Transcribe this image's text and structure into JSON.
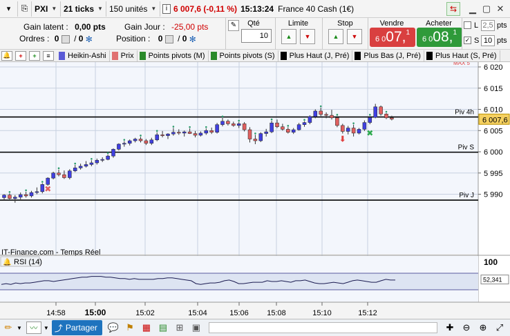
{
  "titlebar": {
    "symbol": "PXI",
    "interval": "21 ticks",
    "units": "150 unités",
    "price_change": "6 007,6 (-0,11 %)",
    "time": "15:13:24",
    "instrument": "France 40 Cash (1€)"
  },
  "infobar": {
    "gain_latent_label": "Gain latent :",
    "gain_latent_value": "0,00 pts",
    "gain_jour_label": "Gain Jour :",
    "gain_jour_value": "-25,00 pts",
    "ordres_label": "Ordres :",
    "ordres_a": "0",
    "ordres_b": "0",
    "position_label": "Position :",
    "position_a": "0",
    "position_b": "0",
    "qty_label": "Qté",
    "qty_value": "10",
    "limit_label": "Limite",
    "stop_label": "Stop",
    "sell_label": "Vendre",
    "sell_prefix": "6 0",
    "sell_big": "07,",
    "sell_sup": "1",
    "buy_label": "Acheter",
    "buy_prefix": "6 0",
    "buy_big": "08,",
    "buy_sup": "1",
    "l_label": "L",
    "l_value": "2,5",
    "l_unit": "pts",
    "s_label": "S",
    "s_value": "10",
    "s_unit": "pts"
  },
  "indicators": [
    {
      "label": "Heikin-Ashi",
      "color": "#5b5bd6"
    },
    {
      "label": "Prix",
      "color": "#e07070"
    },
    {
      "label": "Points pivots (M)",
      "color": "#2a8a2a"
    },
    {
      "label": "Points pivots (S)",
      "color": "#2a8a2a"
    },
    {
      "label": "Plus Haut (J, Pré)",
      "color": "#000000"
    },
    {
      "label": "Plus Bas (J, Pré)",
      "color": "#000000"
    },
    {
      "label": "Plus Haut (S, Pré)",
      "color": "#000000"
    }
  ],
  "chart": {
    "y_ticks": [
      "6 020",
      "6 015",
      "6 010",
      "6 005",
      "6 000",
      "5 995",
      "5 990"
    ],
    "pivot_lines": [
      {
        "label": "Piv 4h",
        "value": 6008.2
      },
      {
        "label": "Piv S",
        "value": 5999.9
      },
      {
        "label": "Piv J",
        "value": 5988.6
      }
    ],
    "top_line_label": "MAX 5",
    "current_price": "6 007,6",
    "watermark": "IT-Finance.com - Temps Réel",
    "rsi_label": "RSI (14)",
    "rsi_value": "52,341",
    "rsi_top_label": "100",
    "x_ticks": [
      "14:58",
      "15:00",
      "15:02",
      "15:04",
      "15:06",
      "15:08",
      "15:10",
      "15:12"
    ],
    "x_bold_tick": "15:00",
    "colors": {
      "up": "#4040e0",
      "down": "#e06060",
      "grid": "#c7d0e0",
      "bg": "#f3f6fc",
      "rsi_band": "#dde4f2"
    }
  },
  "candles": [
    [
      5989.2,
      5990.0,
      5988.6,
      5989.8
    ],
    [
      5989.8,
      5990.2,
      5988.8,
      5989.0
    ],
    [
      5989.0,
      5989.8,
      5988.0,
      5989.3
    ],
    [
      5989.3,
      5990.4,
      5988.8,
      5989.9
    ],
    [
      5989.9,
      5990.6,
      5989.2,
      5989.6
    ],
    [
      5989.6,
      5990.8,
      5989.2,
      5990.4
    ],
    [
      5990.4,
      5991.6,
      5990.0,
      5990.6
    ],
    [
      5990.6,
      5992.6,
      5990.2,
      5992.3
    ],
    [
      5992.3,
      5994.0,
      5992.0,
      5993.8
    ],
    [
      5993.8,
      5995.3,
      5993.5,
      5995.0
    ],
    [
      5995.0,
      5995.8,
      5994.2,
      5994.6
    ],
    [
      5994.6,
      5995.6,
      5993.6,
      5993.9
    ],
    [
      5993.9,
      5995.9,
      5993.5,
      5995.5
    ],
    [
      5995.5,
      5996.9,
      5995.2,
      5996.2
    ],
    [
      5996.2,
      5997.2,
      5995.8,
      5996.6
    ],
    [
      5996.6,
      5997.8,
      5996.3,
      5997.0
    ],
    [
      5997.0,
      5998.0,
      5996.6,
      5997.4
    ],
    [
      5997.4,
      5998.4,
      5997.0,
      5998.0
    ],
    [
      5998.0,
      5998.7,
      5997.6,
      5998.2
    ],
    [
      5998.2,
      5999.4,
      5998.0,
      5999.0
    ],
    [
      5999.0,
      6000.8,
      5998.6,
      6000.6
    ],
    [
      6000.6,
      6002.0,
      6000.3,
      6001.8
    ],
    [
      6001.8,
      6002.5,
      6001.2,
      6002.0
    ],
    [
      6002.0,
      6002.9,
      6001.5,
      6002.6
    ],
    [
      6002.6,
      6003.3,
      6002.2,
      6003.0
    ],
    [
      6003.0,
      6003.5,
      6002.2,
      6002.6
    ],
    [
      6002.6,
      6003.0,
      6001.6,
      6002.0
    ],
    [
      6002.0,
      6003.3,
      6001.6,
      6002.8
    ],
    [
      6002.8,
      6004.6,
      6002.5,
      6004.0
    ],
    [
      6004.0,
      6004.9,
      6003.4,
      6003.8
    ],
    [
      6003.8,
      6004.4,
      6003.0,
      6004.2
    ],
    [
      6004.2,
      6005.6,
      6003.8,
      6004.6
    ],
    [
      6004.6,
      6005.3,
      6004.0,
      6004.4
    ],
    [
      6004.4,
      6005.0,
      6003.6,
      6004.7
    ],
    [
      6004.7,
      6005.5,
      6004.2,
      6004.3
    ],
    [
      6004.3,
      6004.9,
      6003.4,
      6003.9
    ],
    [
      6003.9,
      6004.8,
      6003.6,
      6004.4
    ],
    [
      6004.4,
      6005.5,
      6004.0,
      6005.0
    ],
    [
      6005.0,
      6005.7,
      6004.2,
      6004.6
    ],
    [
      6004.6,
      6006.8,
      6004.3,
      6006.4
    ],
    [
      6006.4,
      6008.0,
      6006.0,
      6007.2
    ],
    [
      6007.2,
      6007.6,
      6006.2,
      6006.6
    ],
    [
      6006.6,
      6007.1,
      6005.9,
      6006.2
    ],
    [
      6006.2,
      6007.0,
      6005.6,
      6006.6
    ],
    [
      6006.6,
      6007.0,
      6004.8,
      6005.2
    ],
    [
      6005.2,
      6005.8,
      6002.2,
      6003.0
    ],
    [
      6003.0,
      6004.0,
      6001.8,
      6002.6
    ],
    [
      6002.6,
      6004.6,
      6002.3,
      6004.3
    ],
    [
      6004.3,
      6005.4,
      6003.6,
      6004.7
    ],
    [
      6004.7,
      6007.3,
      6004.4,
      6006.8
    ],
    [
      6006.8,
      6007.6,
      6005.6,
      6005.9
    ],
    [
      6005.9,
      6006.6,
      6005.0,
      6005.3
    ],
    [
      6005.3,
      6005.8,
      6004.3,
      6004.6
    ],
    [
      6004.6,
      6005.6,
      6004.2,
      6005.2
    ],
    [
      6005.2,
      6006.8,
      6005.0,
      6006.4
    ],
    [
      6006.4,
      6007.2,
      6005.9,
      6006.9
    ],
    [
      6006.9,
      6008.6,
      6006.5,
      6008.3
    ],
    [
      6008.3,
      6010.0,
      6007.9,
      6009.6
    ],
    [
      6009.6,
      6010.4,
      6008.4,
      6008.8
    ],
    [
      6008.8,
      6009.3,
      6007.9,
      6008.6
    ],
    [
      6008.6,
      6009.9,
      6007.6,
      6008.0
    ],
    [
      6008.0,
      6008.4,
      6005.8,
      6006.2
    ],
    [
      6006.2,
      6006.6,
      6004.3,
      6004.8
    ],
    [
      6004.8,
      6006.1,
      6004.1,
      6005.6
    ],
    [
      6005.6,
      6006.4,
      6003.6,
      6004.4
    ],
    [
      6004.4,
      6005.6,
      6004.1,
      6005.3
    ],
    [
      6005.3,
      6007.4,
      6004.9,
      6006.9
    ],
    [
      6006.9,
      6008.4,
      6006.5,
      6008.1
    ],
    [
      6008.1,
      6011.3,
      6007.9,
      6010.6
    ],
    [
      6010.6,
      6010.9,
      6008.5,
      6008.9
    ],
    [
      6008.9,
      6009.1,
      6007.7,
      6008.0
    ],
    [
      6008.0,
      6008.5,
      6007.4,
      6007.7
    ]
  ],
  "rsi": [
    46,
    47,
    46,
    48,
    47,
    48,
    48,
    49,
    50,
    51,
    51,
    50,
    51,
    52,
    53,
    54,
    55,
    56,
    56,
    57,
    57,
    57,
    56,
    56,
    55,
    54,
    54,
    53,
    54,
    53,
    53,
    53,
    53,
    54,
    54,
    55,
    55,
    54,
    53,
    52,
    51,
    47,
    46,
    47,
    48,
    48,
    49,
    51,
    52,
    50,
    47,
    47,
    48,
    49,
    49,
    49,
    51,
    50,
    50,
    51,
    50,
    49,
    51,
    51,
    52,
    50,
    48,
    47,
    47,
    48,
    49,
    48,
    47,
    49,
    51,
    52,
    51,
    50,
    49,
    49,
    51,
    53,
    52,
    52
  ],
  "toolbar": {
    "share_label": "Partager"
  }
}
